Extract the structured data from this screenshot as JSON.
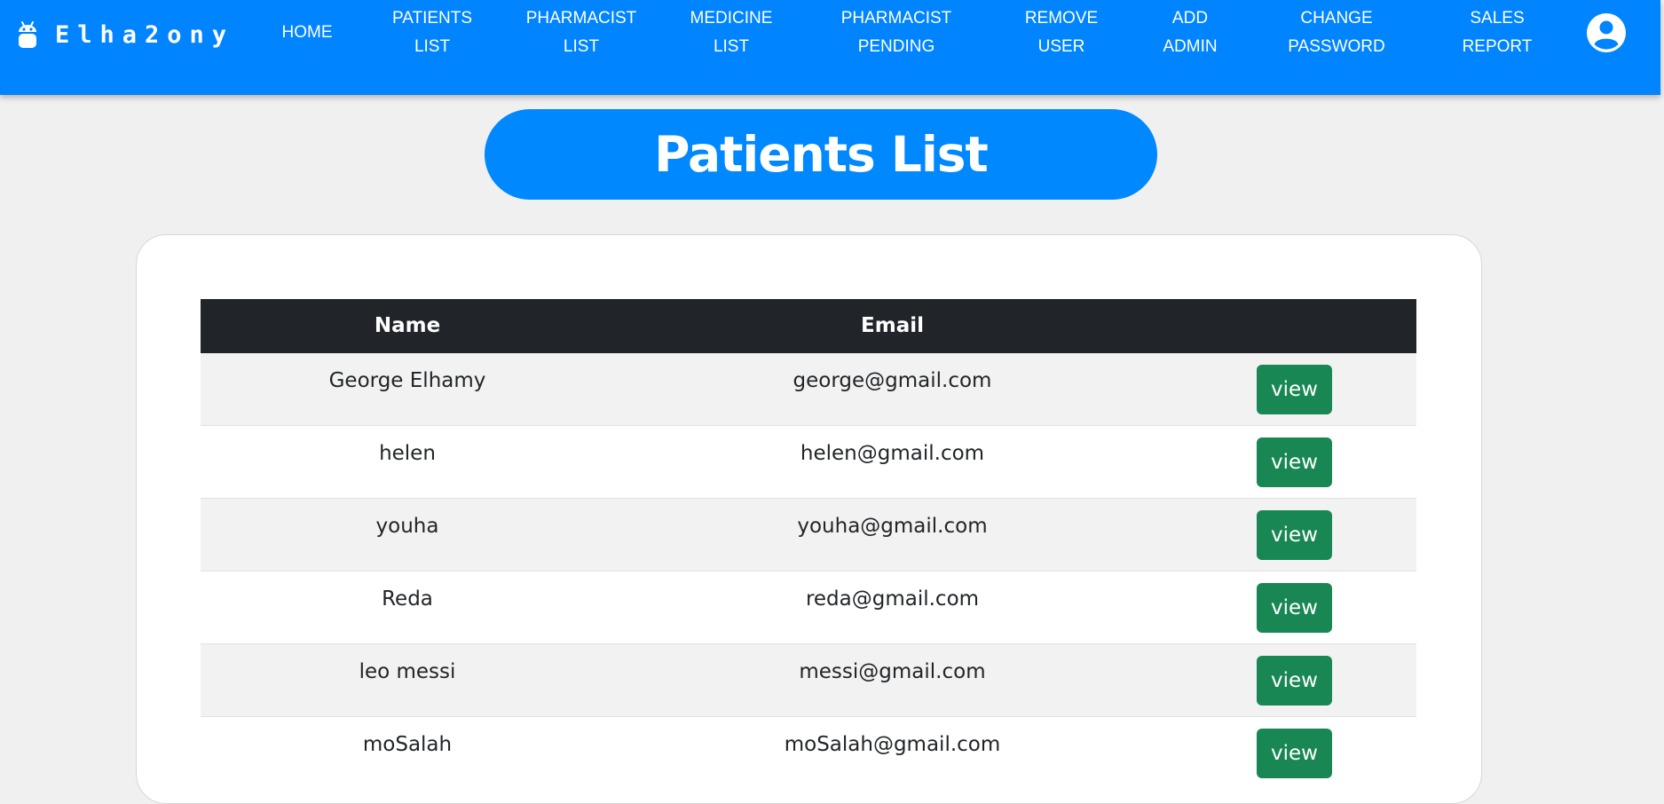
{
  "brand": {
    "name": "Elha2ony",
    "icon": "android-icon"
  },
  "nav": {
    "items": [
      {
        "line1": "HOME",
        "line2": ""
      },
      {
        "line1": "PATIENTS",
        "line2": "LIST"
      },
      {
        "line1": "PHARMACIST",
        "line2": "LIST"
      },
      {
        "line1": "MEDICINE",
        "line2": "LIST"
      },
      {
        "line1": "PHARMACIST",
        "line2": "PENDING"
      },
      {
        "line1": "REMOVE",
        "line2": "USER"
      },
      {
        "line1": "ADD",
        "line2": "ADMIN"
      },
      {
        "line1": "CHANGE",
        "line2": "PASSWORD"
      },
      {
        "line1": "SALES",
        "line2": "REPORT"
      }
    ],
    "account_icon": "account-circle-icon"
  },
  "page": {
    "title": "Patients List"
  },
  "table": {
    "headers": {
      "name": "Name",
      "email": "Email",
      "action": ""
    },
    "view_label": "view",
    "rows": [
      {
        "name": "George Elhamy",
        "email": "george@gmail.com"
      },
      {
        "name": "helen",
        "email": "helen@gmail.com"
      },
      {
        "name": "youha",
        "email": "youha@gmail.com"
      },
      {
        "name": "Reda",
        "email": "reda@gmail.com"
      },
      {
        "name": "leo messi",
        "email": "messi@gmail.com"
      },
      {
        "name": "moSalah",
        "email": "moSalah@gmail.com"
      }
    ]
  },
  "colors": {
    "navbar": "#0084ff",
    "title_pill": "#0088ff",
    "table_header": "#212529",
    "view_button": "#198754",
    "background": "#f0f0f0"
  }
}
